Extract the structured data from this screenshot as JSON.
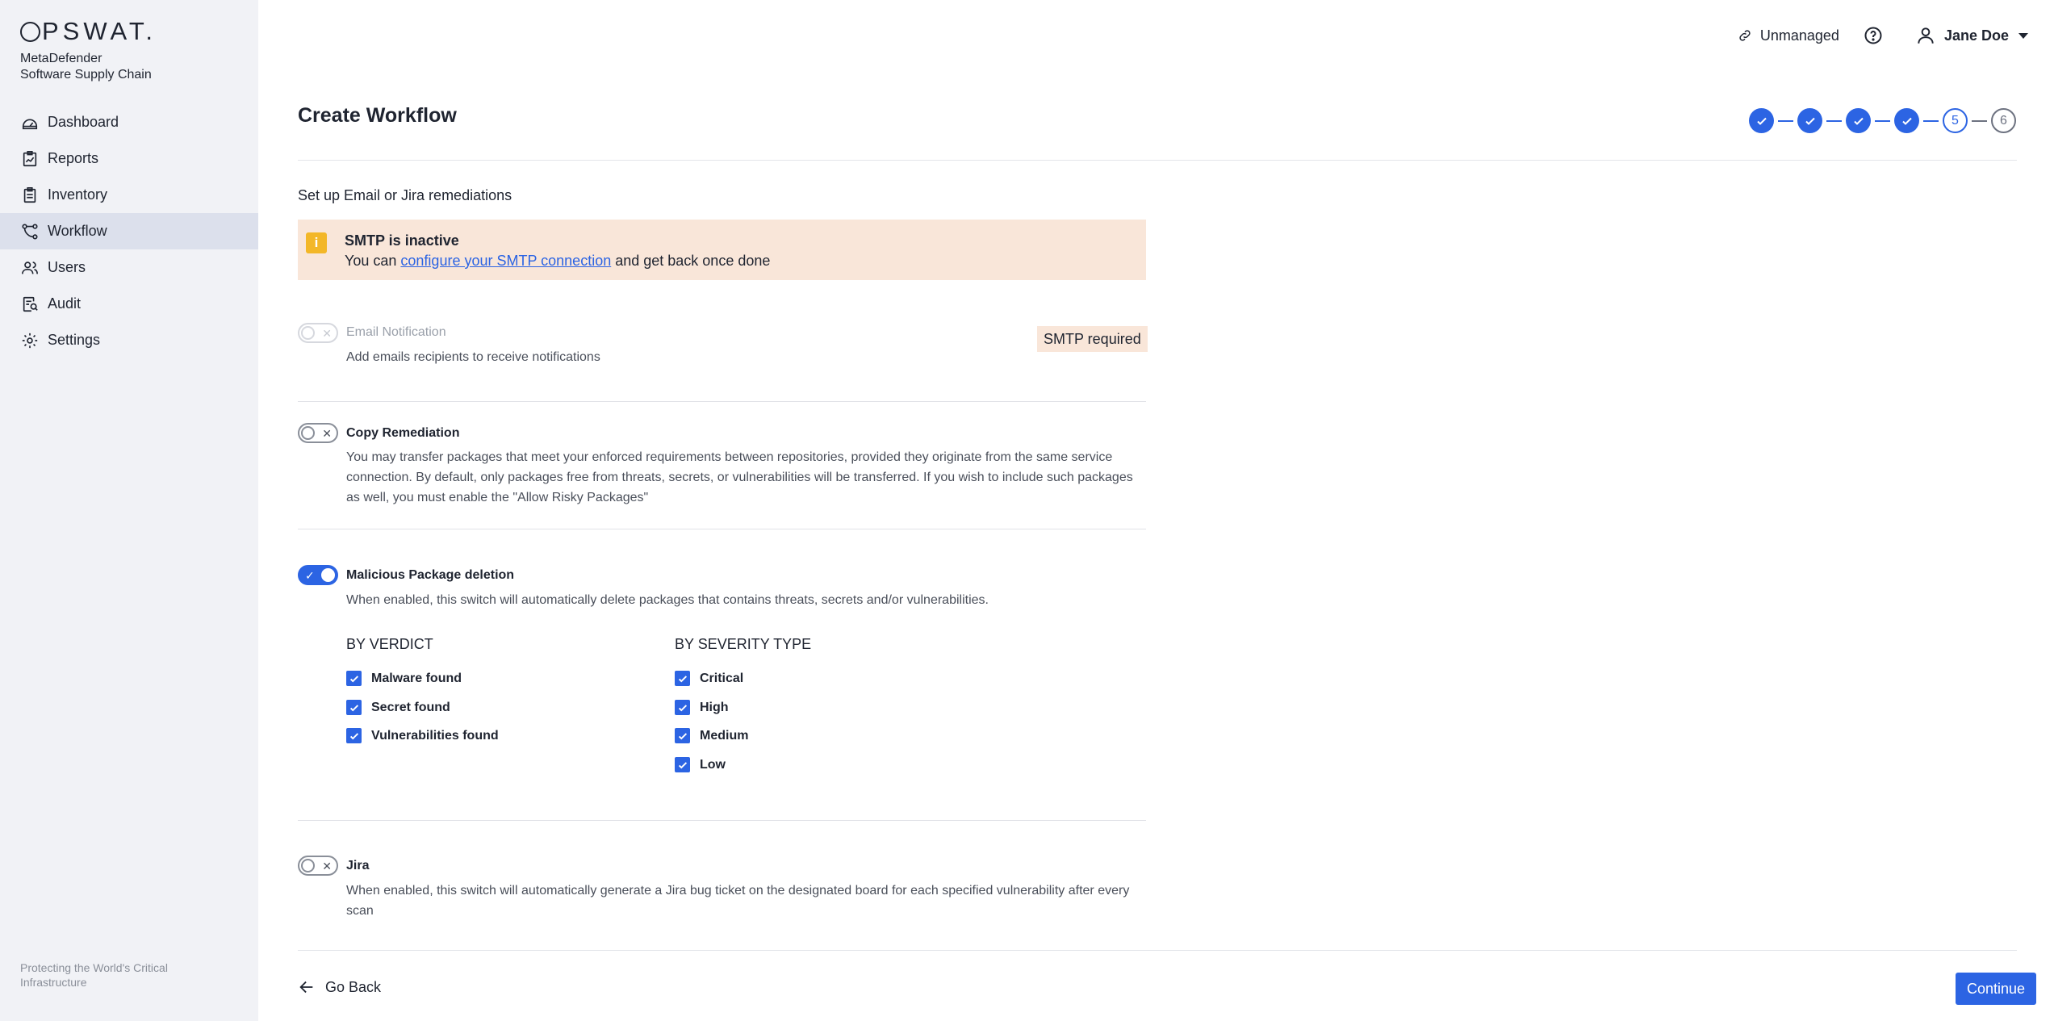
{
  "brand": {
    "logo": "PSWAT.",
    "product_line1": "MetaDefender",
    "product_line2": "Software Supply Chain"
  },
  "sidebar": {
    "items": [
      {
        "label": "Dashboard",
        "icon": "dashboard-icon"
      },
      {
        "label": "Reports",
        "icon": "reports-icon"
      },
      {
        "label": "Inventory",
        "icon": "inventory-icon"
      },
      {
        "label": "Workflow",
        "icon": "workflow-icon",
        "active": true
      },
      {
        "label": "Users",
        "icon": "users-icon"
      },
      {
        "label": "Audit",
        "icon": "audit-icon"
      },
      {
        "label": "Settings",
        "icon": "settings-icon"
      }
    ],
    "footer": "Protecting the World's Critical Infrastructure"
  },
  "topbar": {
    "unmanaged": "Unmanaged",
    "user_name": "Jane Doe"
  },
  "page": {
    "title": "Create Workflow",
    "stepper": {
      "total": 6,
      "completed": 4,
      "current": 5,
      "labels": [
        "5",
        "6"
      ]
    },
    "section_title": "Set up Email or Jira remediations"
  },
  "alert": {
    "title": "SMTP is inactive",
    "text_before": "You can ",
    "link": "configure your SMTP connection",
    "text_after": " and get back once done"
  },
  "options": {
    "email": {
      "title": "Email Notification",
      "description": "Add emails recipients to receive notifications",
      "badge": "SMTP required",
      "enabled": false,
      "disabled": true
    },
    "copy": {
      "title": "Copy Remediation",
      "description": "You may transfer packages that meet your enforced requirements between repositories, provided they originate from the same service connection. By default, only packages free from threats, secrets, or vulnerabilities will be transferred. If you wish to include such packages as well, you must enable the \"Allow Risky Packages\"",
      "enabled": false
    },
    "malicious": {
      "title": "Malicious Package deletion",
      "description": "When enabled, this switch will automatically delete packages that contains threats, secrets and/or vulnerabilities.",
      "enabled": true,
      "by_verdict": {
        "title": "BY VERDICT",
        "items": [
          "Malware found",
          "Secret found",
          "Vulnerabilities found"
        ]
      },
      "by_severity": {
        "title": "BY SEVERITY TYPE",
        "items": [
          "Critical",
          "High",
          "Medium",
          "Low"
        ]
      }
    },
    "jira": {
      "title": "Jira",
      "description": "When enabled, this switch will automatically generate a Jira bug ticket on the designated board for each specified vulnerability after every scan",
      "enabled": false
    }
  },
  "actions": {
    "back": "Go Back",
    "continue": "Continue"
  },
  "colors": {
    "accent": "#2c64e3",
    "sidebar_bg": "#f1f2f6",
    "sidebar_active": "#dce0ec",
    "alert_bg": "#f9e6d9",
    "alert_icon": "#f3b728"
  }
}
